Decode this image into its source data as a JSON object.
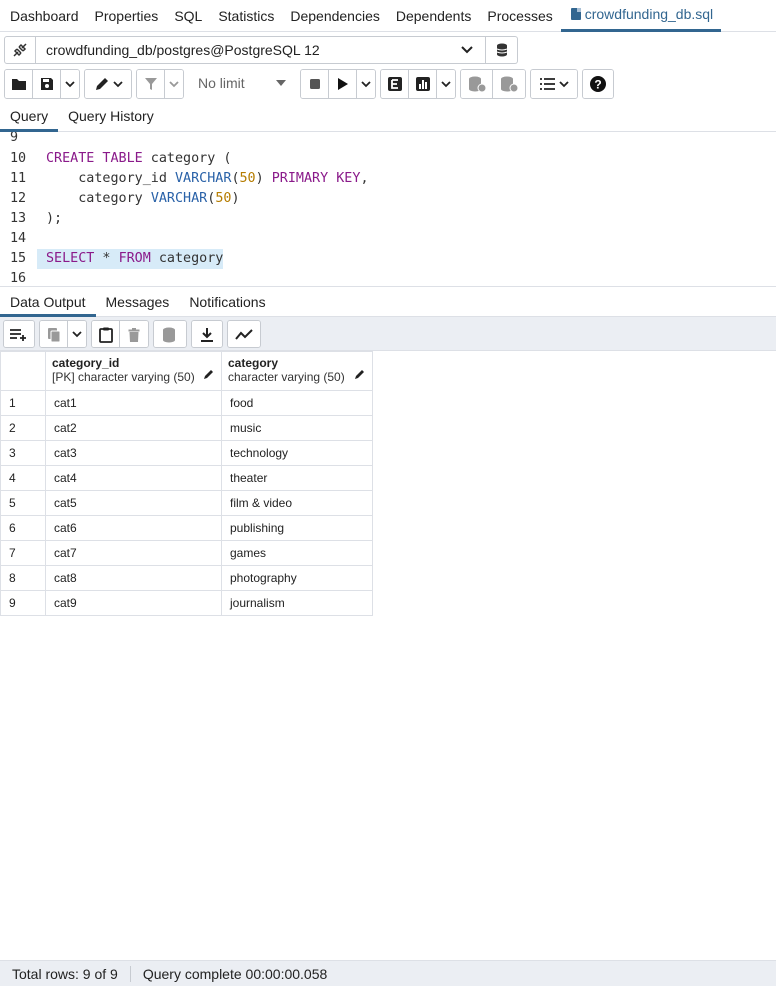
{
  "top_tabs": [
    "Dashboard",
    "Properties",
    "SQL",
    "Statistics",
    "Dependencies",
    "Dependents",
    "Processes"
  ],
  "active_file_tab": "crowdfunding_db.sql",
  "connection": "crowdfunding_db/postgres@PostgreSQL 12",
  "toolbar": {
    "limit_label": "No limit"
  },
  "query_tabs": [
    "Query",
    "Query History"
  ],
  "editor": {
    "line_numbers": [
      "9",
      "10",
      "11",
      "12",
      "13",
      "14",
      "15",
      "16"
    ],
    "lines": {
      "l10": {
        "kw1": "CREATE TABLE",
        "rest": " category ("
      },
      "l11": {
        "indent": "    category_id ",
        "type": "VARCHAR",
        "open": "(",
        "num": "50",
        "close": ") ",
        "kw": "PRIMARY KEY",
        "comma": ","
      },
      "l12": {
        "indent": "    category ",
        "type": "VARCHAR",
        "open": "(",
        "num": "50",
        "close": ")"
      },
      "l13": {
        "text": ");"
      },
      "l15": {
        "kw1": "SELECT",
        "star": " * ",
        "kw2": "FROM",
        "rest": " category"
      }
    }
  },
  "result_tabs": [
    "Data Output",
    "Messages",
    "Notifications"
  ],
  "grid": {
    "columns": [
      {
        "name": "category_id",
        "type": "[PK] character varying (50)"
      },
      {
        "name": "category",
        "type": "character varying (50)"
      }
    ],
    "rows": [
      {
        "n": "1",
        "id": "cat1",
        "category": "food"
      },
      {
        "n": "2",
        "id": "cat2",
        "category": "music"
      },
      {
        "n": "3",
        "id": "cat3",
        "category": "technology"
      },
      {
        "n": "4",
        "id": "cat4",
        "category": "theater"
      },
      {
        "n": "5",
        "id": "cat5",
        "category": "film & video"
      },
      {
        "n": "6",
        "id": "cat6",
        "category": "publishing"
      },
      {
        "n": "7",
        "id": "cat7",
        "category": "games"
      },
      {
        "n": "8",
        "id": "cat8",
        "category": "photography"
      },
      {
        "n": "9",
        "id": "cat9",
        "category": "journalism"
      }
    ]
  },
  "status": {
    "total_rows": "Total rows: 9 of 9",
    "query_status": "Query complete 00:00:00.058"
  }
}
